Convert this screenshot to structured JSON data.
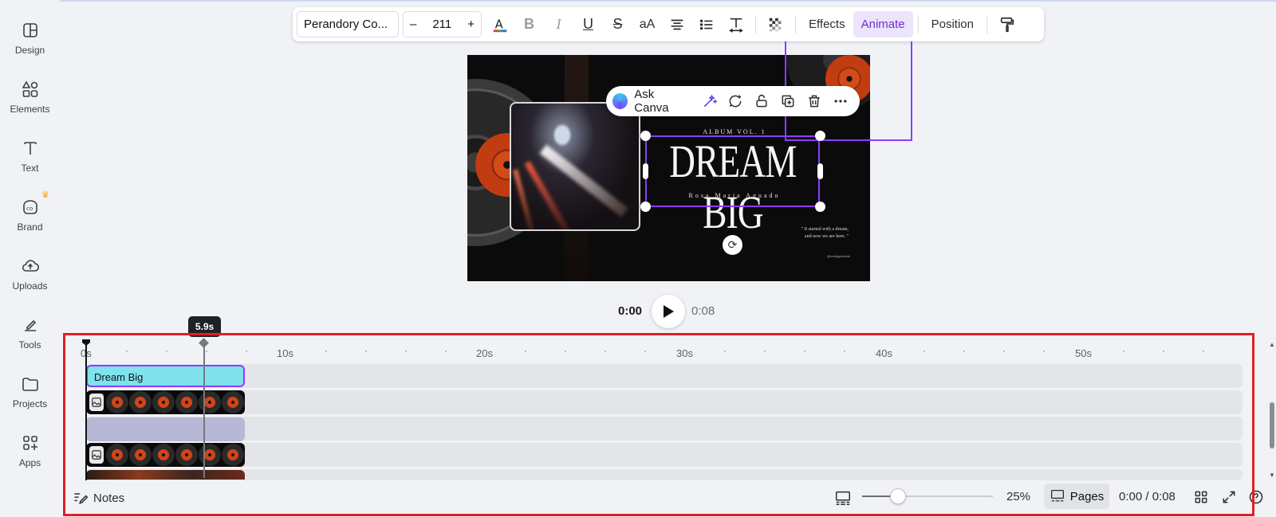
{
  "sidebar": {
    "items": [
      {
        "label": "Design"
      },
      {
        "label": "Elements"
      },
      {
        "label": "Text"
      },
      {
        "label": "Brand"
      },
      {
        "label": "Uploads"
      },
      {
        "label": "Tools"
      },
      {
        "label": "Projects"
      },
      {
        "label": "Apps"
      }
    ]
  },
  "toolbar": {
    "font_name": "Perandory Co...",
    "font_size": "211",
    "decrease": "–",
    "increase": "+",
    "effects_label": "Effects",
    "animate_label": "Animate",
    "position_label": "Position",
    "accent": "#8b3dff"
  },
  "canvas": {
    "album_vol": "ALBUM VOL. 1",
    "title": "DREAM BIG",
    "author": "Rosa Maria Aguado",
    "quote": "\" It started with a dream, and now we are here. \"",
    "handle": "@reallygreatsite"
  },
  "ask_canva": {
    "label": "Ask Canva"
  },
  "playback": {
    "current": "0:00",
    "total": "0:08"
  },
  "timeline": {
    "ruler": [
      "0s",
      "10s",
      "20s",
      "30s",
      "40s",
      "50s"
    ],
    "marker": "5.9s",
    "text_clip": "Dream Big"
  },
  "bottom_bar": {
    "notes_label": "Notes",
    "zoom": "25%",
    "zoom_level": 0.25,
    "pages_label": "Pages",
    "page_time": "0:00 / 0:08"
  }
}
